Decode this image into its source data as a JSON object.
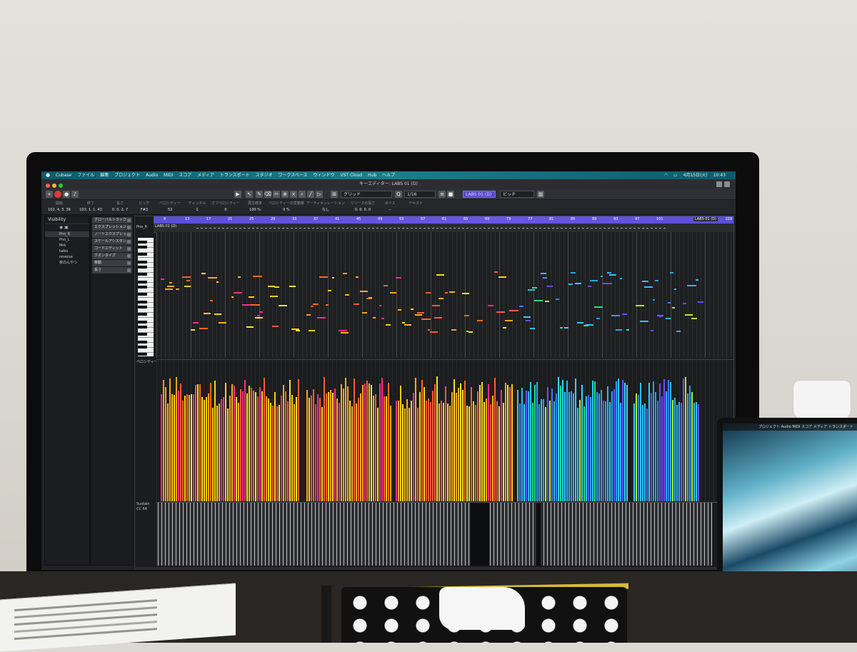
{
  "menubar": {
    "items": [
      "Cubase",
      "ファイル",
      "編集",
      "プロジェクト",
      "Audio",
      "MIDI",
      "スコア",
      "メディア",
      "トランスポート",
      "スタジオ",
      "ワークスペース",
      "ウィンドウ",
      "VST Cloud",
      "Hub",
      "ヘルプ"
    ],
    "date": "4月15日(火)",
    "time": "10:43"
  },
  "window": {
    "title": "キーエディター: LABS 01 (D)"
  },
  "toolbar": {
    "quantize_mode": "グリッド",
    "quantize_value": "1/16",
    "track_select": "LABS 01 (D)",
    "lane_select": "ピッチ"
  },
  "infoline": {
    "cells": [
      {
        "label": "開始",
        "value": "102. 4. 3. 36"
      },
      {
        "label": "終了",
        "value": "103. 1. 1. 43"
      },
      {
        "label": "長さ",
        "value": "0. 0. 2. 7"
      },
      {
        "label": "ピッチ",
        "value": "F#3"
      },
      {
        "label": "ベロシティー",
        "value": "53"
      },
      {
        "label": "チャンネル",
        "value": "1"
      },
      {
        "label": "オフベロシティー",
        "value": "0"
      },
      {
        "label": "再生確率",
        "value": "100 %"
      },
      {
        "label": "ベロシティーの変動量",
        "value": "0 %"
      },
      {
        "label": "アーティキュレーション",
        "value": "なし"
      },
      {
        "label": "リリースの長さ",
        "value": "0. 0. 0. 0"
      },
      {
        "label": "ボイス",
        "value": "--"
      },
      {
        "label": "テキスト",
        "value": ""
      }
    ]
  },
  "inspector": {
    "title": "Visibility",
    "items": [
      "Pno_R",
      "Pno_L",
      "Mrk",
      "taiko",
      "reverse",
      "夜のんやつ"
    ]
  },
  "sections": [
    "グローバルトラック",
    "エクスプレッション",
    "ノートエクスプレッ...",
    "スケールアシスタン...",
    "コードエディット",
    "クオンタイズ",
    "移動",
    "長さ"
  ],
  "editor": {
    "track_short": "Pno_R",
    "part_name": "LABS 01 (D)",
    "ruler_marks": [
      "9",
      "13",
      "17",
      "21",
      "25",
      "29",
      "33",
      "37",
      "41",
      "45",
      "49",
      "53",
      "57",
      "61",
      "65",
      "69",
      "73",
      "77",
      "81",
      "85",
      "89",
      "93",
      "97",
      "101"
    ],
    "ruler_name": "LABS 01 (D)",
    "ruler_end": "109",
    "velocity_label": "ベロシティー",
    "cc_label": "Sustain",
    "cc_value": "CC 64"
  },
  "laptop": {
    "menubar": [
      "プロジェクト",
      "Audio",
      "MIDI",
      "スコア",
      "メディア",
      "トランスポート"
    ]
  },
  "colors": {
    "ruler": "#6a56e6",
    "menubar": "#1e7c8a",
    "record": "#e23a34"
  }
}
